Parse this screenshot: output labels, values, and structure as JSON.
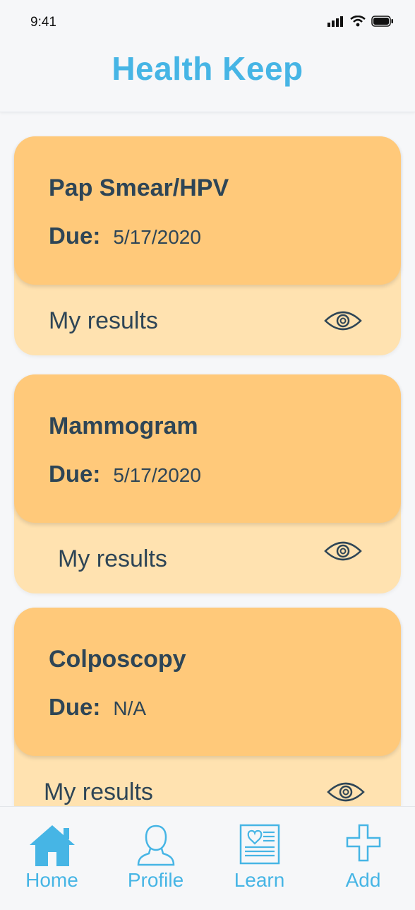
{
  "status": {
    "time": "9:41"
  },
  "header": {
    "title": "Health Keep"
  },
  "cards": [
    {
      "title": "Pap Smear/HPV",
      "due_label": "Due:",
      "due_value": "5/17/2020",
      "results_label": "My results"
    },
    {
      "title": "Mammogram",
      "due_label": "Due:",
      "due_value": "5/17/2020",
      "results_label": "My results"
    },
    {
      "title": "Colposcopy",
      "due_label": "Due:",
      "due_value": "N/A",
      "results_label": "My results"
    }
  ],
  "nav": [
    {
      "label": "Home",
      "icon": "home-icon"
    },
    {
      "label": "Profile",
      "icon": "profile-icon"
    },
    {
      "label": "Learn",
      "icon": "learn-icon"
    },
    {
      "label": "Add",
      "icon": "add-icon"
    }
  ],
  "colors": {
    "accent": "#46b5e5",
    "card_top": "#ffc97a",
    "card_bottom": "#ffe2b0",
    "text": "#2e4556"
  }
}
